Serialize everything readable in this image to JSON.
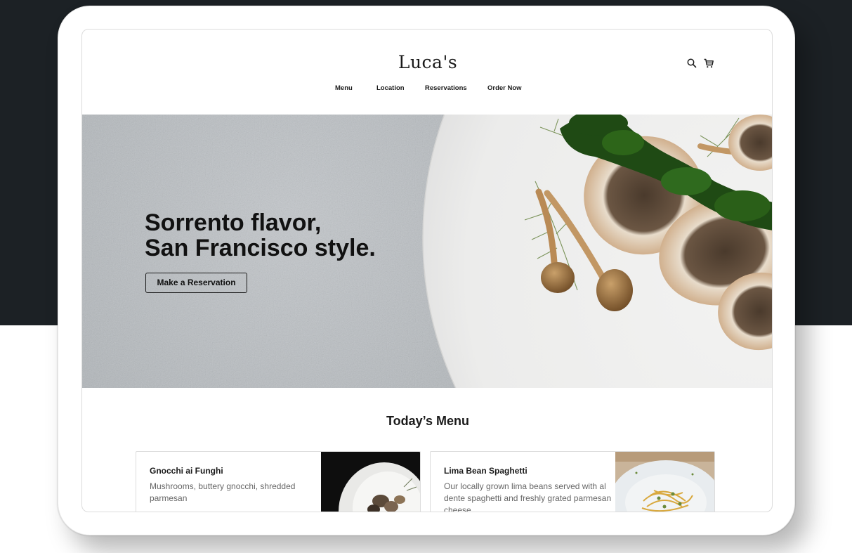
{
  "header": {
    "logo": "Luca's",
    "nav": [
      "Menu",
      "Location",
      "Reservations",
      "Order Now"
    ],
    "icons": [
      "search-icon",
      "cart-icon"
    ]
  },
  "hero": {
    "title_line1": "Sorrento flavor,",
    "title_line2": "San Francisco style.",
    "cta_label": "Make a Reservation"
  },
  "menu": {
    "title": "Today’s Menu",
    "items": [
      {
        "name": "Gnocchi ai Funghi",
        "description": "Mushrooms, buttery gnocchi, shredded parmesan"
      },
      {
        "name": "Lima Bean Spaghetti",
        "description": "Our locally grown lima beans served with al dente spaghetti and freshly grated parmesan cheese"
      }
    ]
  },
  "colors": {
    "page_dark": "#1c2125",
    "text": "#1a1a1a",
    "muted_text": "#666666"
  }
}
